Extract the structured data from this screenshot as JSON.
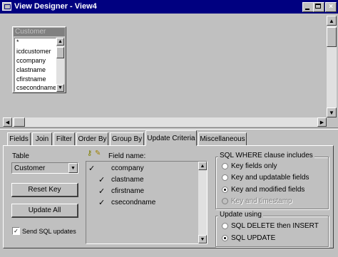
{
  "window": {
    "title": "View Designer - View4"
  },
  "table_box": {
    "title": "Customer",
    "fields": [
      "*",
      "icdcustomer",
      "ccompany",
      "clastname",
      "cfirstname",
      "csecondname"
    ]
  },
  "tabs": [
    {
      "label": "Fields"
    },
    {
      "label": "Join"
    },
    {
      "label": "Filter"
    },
    {
      "label": "Order By"
    },
    {
      "label": "Group By"
    },
    {
      "label": "Update Criteria"
    },
    {
      "label": "Miscellaneous"
    }
  ],
  "update_criteria": {
    "table_label": "Table",
    "table_value": "Customer",
    "reset_key_label": "Reset Key",
    "update_all_label": "Update All",
    "send_sql_label": "Send SQL updates",
    "send_sql_checked": true,
    "field_name_header": "Field name:",
    "fields": [
      {
        "name": "ccompany",
        "key": true,
        "update": false
      },
      {
        "name": "clastname",
        "key": false,
        "update": true
      },
      {
        "name": "cfirstname",
        "key": false,
        "update": true
      },
      {
        "name": "csecondname",
        "key": false,
        "update": true
      }
    ],
    "where_group_label": "SQL WHERE clause includes",
    "where_options": [
      {
        "label": "Key fields only",
        "selected": false,
        "enabled": true
      },
      {
        "label": "Key and updatable fields",
        "selected": false,
        "enabled": true
      },
      {
        "label": "Key and modified fields",
        "selected": true,
        "enabled": true
      },
      {
        "label": "Key and timestamp",
        "selected": false,
        "enabled": false
      }
    ],
    "update_group_label": "Update using",
    "update_options": [
      {
        "label": "SQL DELETE then INSERT",
        "selected": false
      },
      {
        "label": "SQL UPDATE",
        "selected": true
      }
    ]
  }
}
